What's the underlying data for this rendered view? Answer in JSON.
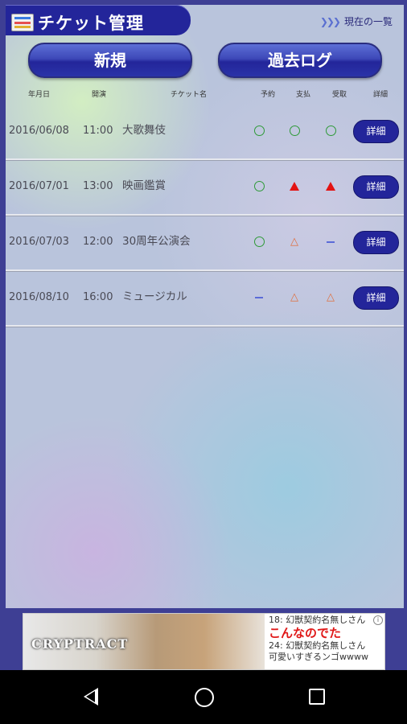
{
  "header": {
    "title": "チケット管理",
    "current_list_link": "現在の一覧"
  },
  "buttons": {
    "new": "新規",
    "past_log": "過去ログ"
  },
  "columns": {
    "date": "年月日",
    "time": "開演",
    "name": "チケット名",
    "reserve": "予約",
    "payment": "支払",
    "receive": "受取",
    "detail": "詳細"
  },
  "rows": [
    {
      "date": "2016/06/08",
      "time": "11:00",
      "name": "大歌舞伎",
      "reserve": "circle",
      "payment": "circle",
      "receive": "circle",
      "detail": "詳細"
    },
    {
      "date": "2016/07/01",
      "time": "13:00",
      "name": "映画鑑賞",
      "reserve": "circle",
      "payment": "filled-triangle",
      "receive": "filled-triangle",
      "detail": "詳細"
    },
    {
      "date": "2016/07/03",
      "time": "12:00",
      "name": "30周年公演会",
      "reserve": "circle",
      "payment": "outline-triangle",
      "receive": "dash",
      "detail": "詳細"
    },
    {
      "date": "2016/08/10",
      "time": "16:00",
      "name": "ミュージカル",
      "reserve": "dash",
      "payment": "outline-triangle",
      "receive": "outline-triangle",
      "detail": "詳細"
    }
  ],
  "ad": {
    "logo": "CRYPTRACT",
    "line1": "18: 幻獣契約名無しさん",
    "line2": "こんなのでた",
    "line3": "24: 幻獣契約名無しさん",
    "line4": "可愛いすぎるンゴwwww"
  },
  "colors": {
    "accent": "#23259a",
    "circle": "#2e9a38",
    "triangle_filled": "#e31313",
    "triangle_outline": "#e07040",
    "dash": "#5b6bd8"
  }
}
